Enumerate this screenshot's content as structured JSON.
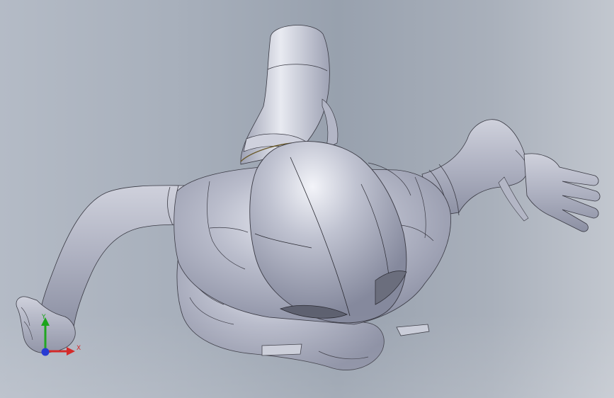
{
  "viewport": {
    "background_top": "#a7afbb",
    "model_fill": "#b9bccb",
    "model_highlight": "#e6e8f0",
    "model_shadow": "#8f93a6",
    "edge_color": "#2a2a32"
  },
  "triad": {
    "icon": "axis-triad-icon",
    "x_label": "X",
    "y_label": "Y",
    "x_color": "#d21e1e",
    "y_color": "#19a319",
    "z_color": "#1c2fd0"
  }
}
